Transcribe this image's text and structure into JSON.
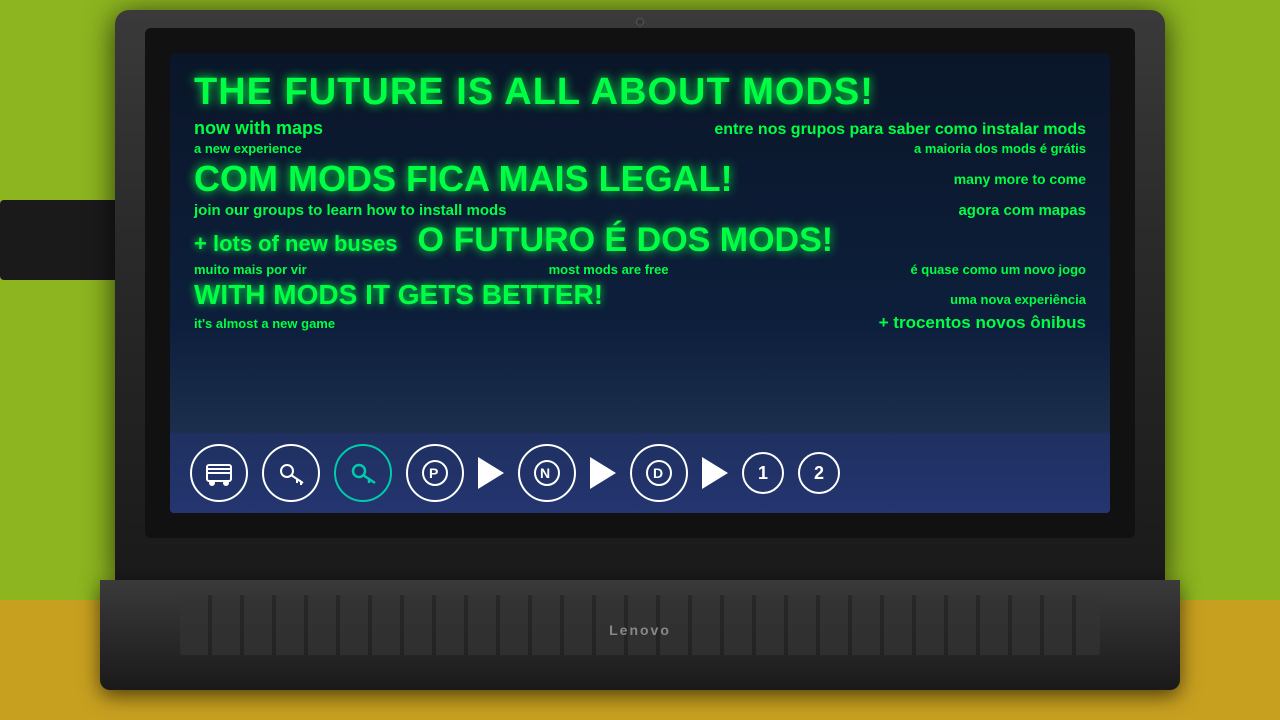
{
  "background": {
    "color": "#8db520"
  },
  "screen": {
    "lines": {
      "title_en": "THE FUTURE IS ALL ABOUT MODS!",
      "sub1_left": "now with maps",
      "sub1_center": "entre nos grupos para saber como instalar mods",
      "sub2_left": "a new experience",
      "sub2_right": "a maioria dos mods é grátis",
      "title_pt": "COM MODS FICA MAIS LEGAL!",
      "many_more": "many more to come",
      "join_groups": "join our groups to learn how to install mods",
      "agora_mapas": "agora com mapas",
      "lots_buses": "+ lots of new buses",
      "title_pt2": "O FUTURO É DOS MODS!",
      "muito_mais": "muito mais por vir",
      "most_mods": "most mods are free",
      "e_quase": "é quase como um novo jogo",
      "title_en2": "WITH MODS IT GETS BETTER!",
      "nova_exp": "uma nova experiência",
      "almost_new": "it's almost a new game",
      "trocentos": "+ trocentos novos ônibus"
    }
  },
  "icons": [
    {
      "name": "bus-icon",
      "type": "bus",
      "active": false
    },
    {
      "name": "key-icon",
      "type": "key",
      "active": false
    },
    {
      "name": "wrench-icon",
      "type": "wrench",
      "active": true
    },
    {
      "name": "p-circle-icon",
      "type": "p-circle",
      "active": false
    },
    {
      "name": "play-icon-1",
      "type": "play",
      "active": false
    },
    {
      "name": "n-circle-icon",
      "type": "N",
      "active": false
    },
    {
      "name": "play-icon-2",
      "type": "play",
      "active": false
    },
    {
      "name": "d-circle-icon",
      "type": "D",
      "active": false
    },
    {
      "name": "play-icon-3",
      "type": "play",
      "active": false
    },
    {
      "name": "num-1-icon",
      "type": "1",
      "active": false
    },
    {
      "name": "num-2-icon",
      "type": "2",
      "active": false
    }
  ],
  "laptop": {
    "brand": "Lenovo"
  }
}
